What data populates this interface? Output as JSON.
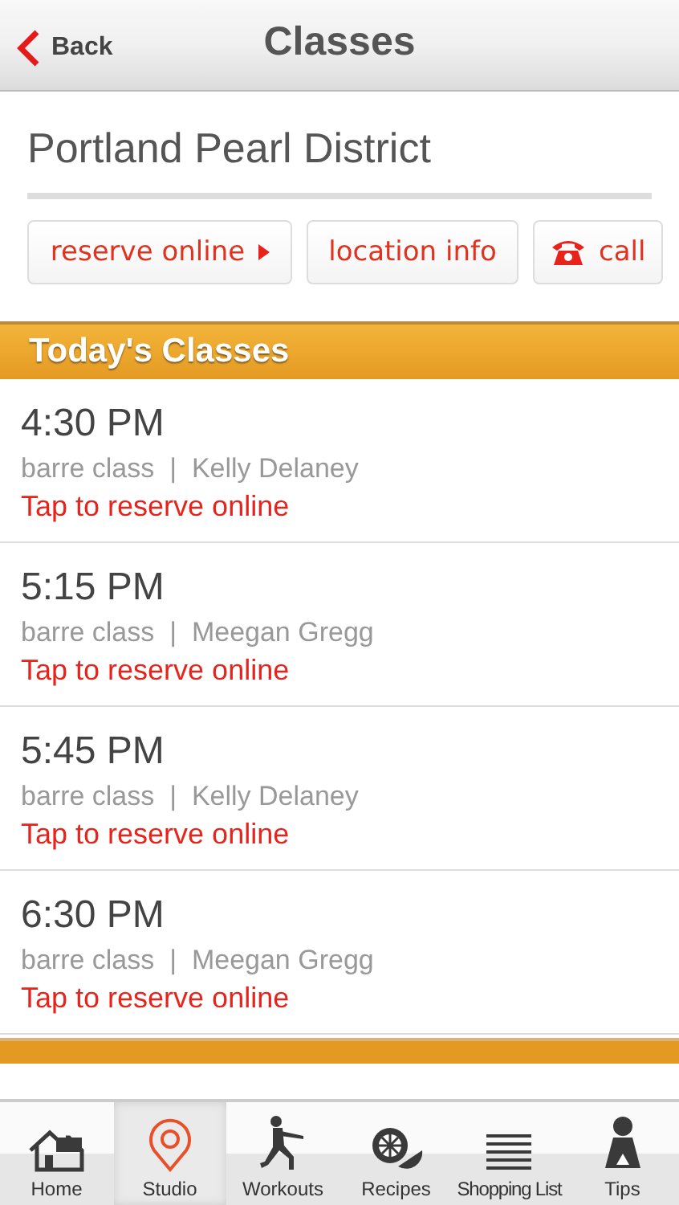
{
  "nav_bar": {
    "back": "Back",
    "title": "Classes"
  },
  "location": {
    "name": "Portland Pearl District"
  },
  "actions": [
    {
      "kind": "reserve",
      "label": "reserve online"
    },
    {
      "kind": "info",
      "label": "location info"
    },
    {
      "kind": "call",
      "label": "call"
    }
  ],
  "today_section": {
    "title": "Today's Classes"
  },
  "classes": [
    {
      "time": "4:30 PM",
      "details": "barre class  |  Kelly Delaney",
      "link": "Tap to reserve online"
    },
    {
      "time": "5:15 PM",
      "details": "barre class  |  Meegan Gregg",
      "link": "Tap to reserve online"
    },
    {
      "time": "5:45 PM",
      "details": "barre class  |  Kelly Delaney",
      "link": "Tap to reserve online"
    },
    {
      "time": "6:30 PM",
      "details": "barre class  |  Meegan Gregg",
      "link": "Tap to reserve online"
    }
  ],
  "tab_bar": [
    {
      "kind": "home",
      "label": "Home",
      "selected": false
    },
    {
      "kind": "studio",
      "label": "Studio",
      "selected": true
    },
    {
      "kind": "workouts",
      "label": "Workouts",
      "selected": false
    },
    {
      "kind": "recipes",
      "label": "Recipes",
      "selected": false
    },
    {
      "kind": "list",
      "label": "Shopping List",
      "selected": false
    },
    {
      "kind": "tips",
      "label": "Tips",
      "selected": false
    }
  ]
}
